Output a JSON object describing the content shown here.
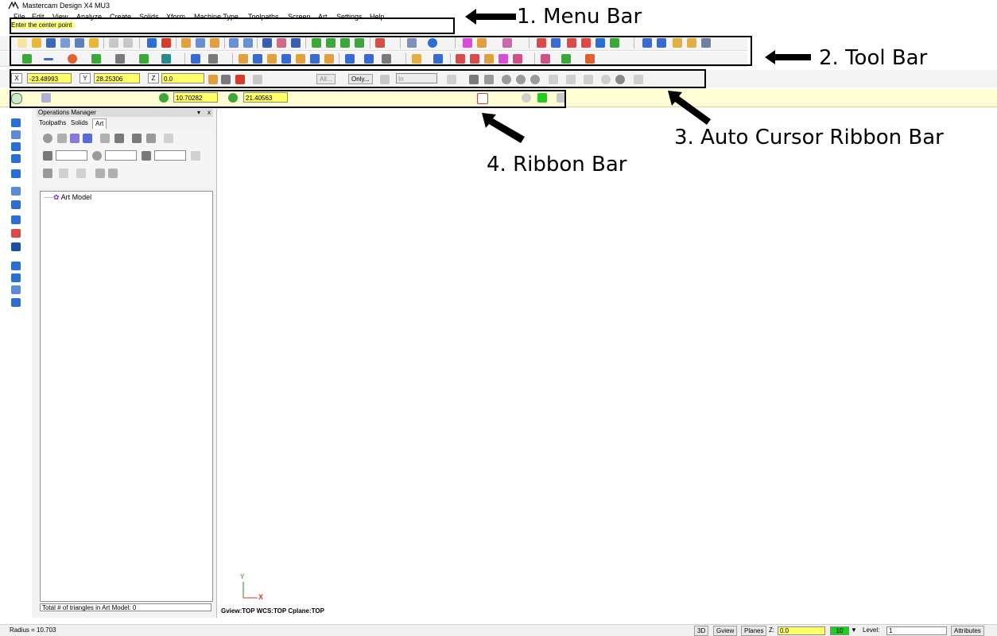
{
  "window": {
    "title": "Mastercam Design X4 MU3"
  },
  "menu": [
    "File",
    "Edit",
    "View",
    "Analyze",
    "Create",
    "Solids",
    "Xform",
    "Machine Type",
    "Toolpaths",
    "Screen",
    "Art",
    "Settings",
    "Help"
  ],
  "prompt": "Enter the center point",
  "auto_cursor": {
    "x_label": "X",
    "x_value": "-23.48993",
    "y_label": "Y",
    "y_value": "28.25306",
    "z_label": "Z",
    "z_value": "0.0",
    "all_label": "All...",
    "only_label": "Only...",
    "in_label": "In"
  },
  "ribbon": {
    "radius_value": "10.70282",
    "diameter_value": "21.40563"
  },
  "ops_manager": {
    "title": "Operations Manager",
    "tabs": [
      "Toolpaths",
      "Solids",
      "Art"
    ],
    "tree_root": "Art Model",
    "triangles_text": "Total # of triangles in Art Model: 0"
  },
  "axes": {
    "y": "Y",
    "x": "X"
  },
  "view_info": "Gview:TOP   WCS:TOP   Cplane:TOP",
  "status": {
    "radius": "Radius = 10.703",
    "btn_3d": "3D",
    "btn_gview": "Gview",
    "btn_planes": "Planes",
    "z_label": "Z:",
    "z_value": "0.0",
    "color_value": "10",
    "level_label": "Level:",
    "level_value": "1",
    "attributes": "Attributes"
  },
  "annotations": {
    "menu_bar": "1. Menu Bar",
    "tool_bar": "2. Tool Bar",
    "auto_cursor": "3. Auto Cursor Ribbon Bar",
    "ribbon_bar": "4. Ribbon Bar"
  },
  "colors": {
    "ribbon_bg": "#fffdd3",
    "field_yellow": "#ffff66",
    "accent_green": "#22cc22",
    "icon_blue": "#2a6fd1"
  }
}
